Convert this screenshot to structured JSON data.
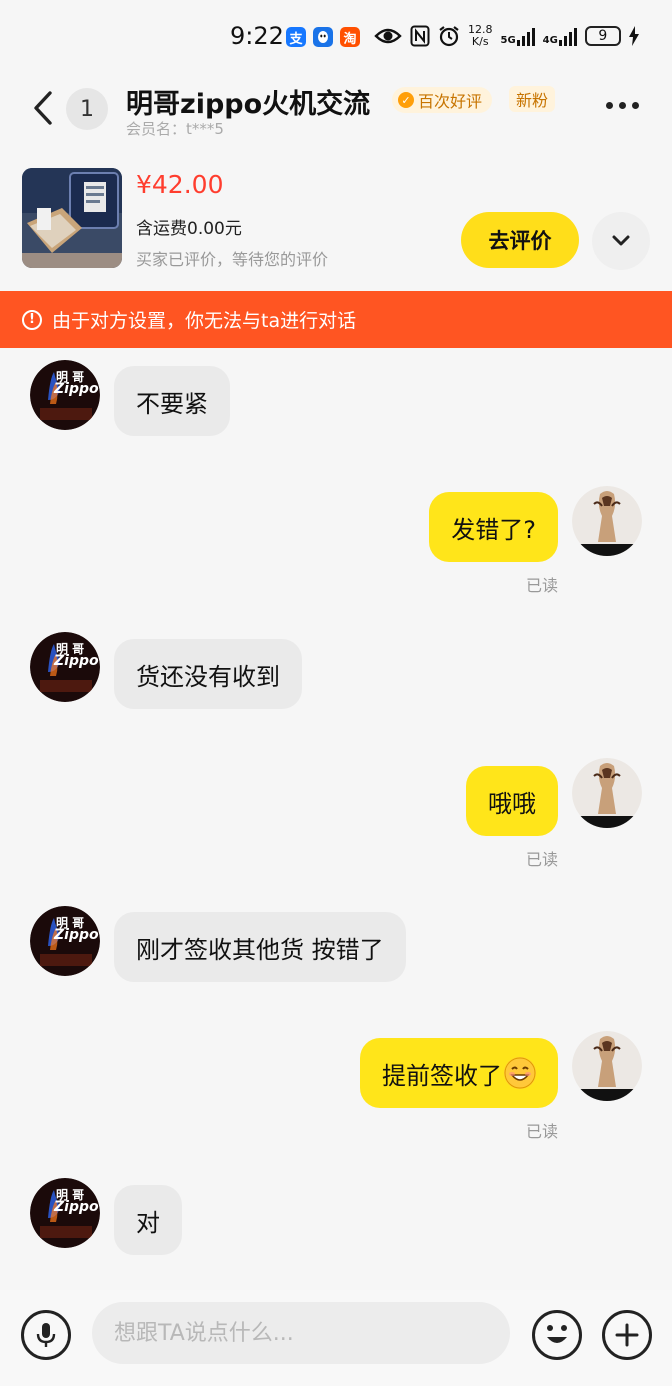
{
  "status_bar": {
    "time": "9:22",
    "net_speed_value": "12.8",
    "net_speed_unit": "K/s",
    "network_5g": "5G",
    "network_4g": "4G",
    "battery": "9",
    "app_icons": [
      "alipay-icon",
      "qq-icon",
      "taobao-icon"
    ],
    "alipay_glyph": "支",
    "taobao_glyph": "淘"
  },
  "header": {
    "unread_count": "1",
    "title": "明哥zippo火机交流",
    "badge_good_reviews": "百次好评",
    "badge_new_fan": "新粉",
    "member_label": "会员名：t***5"
  },
  "product": {
    "price": "¥42.00",
    "shipping": "含运费0.00元",
    "review_status": "买家已评价，等待您的评价",
    "review_button": "去评价"
  },
  "warning": {
    "text": "由于对方设置，你无法与ta进行对话",
    "icon_glyph": "!"
  },
  "messages": [
    {
      "side": "in",
      "text": "不要紧"
    },
    {
      "side": "out",
      "text": "发错了?",
      "status": "已读"
    },
    {
      "side": "in",
      "text": "货还没有收到"
    },
    {
      "side": "out",
      "text": "哦哦",
      "status": "已读"
    },
    {
      "side": "in",
      "text": "刚才签收其他货 按错了"
    },
    {
      "side": "out",
      "text": "提前签收了",
      "status": "已读"
    },
    {
      "side": "in",
      "text": "对"
    }
  ],
  "seller_avatar": {
    "name_chars": "明 哥",
    "brand": "Zippo"
  },
  "input": {
    "placeholder": "想跟TA说点什么..."
  },
  "colors": {
    "accent_yellow": "#ffe51a",
    "warning_orange": "#ff5522",
    "price_red": "#ff3d2e"
  }
}
